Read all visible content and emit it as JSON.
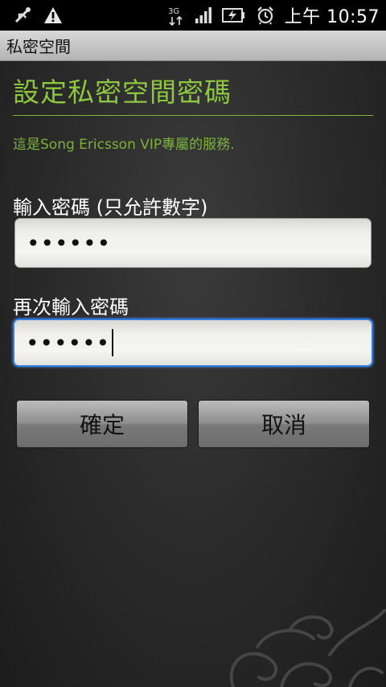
{
  "status_bar": {
    "network": "3G",
    "clock": "上午 10:57"
  },
  "title_bar": {
    "title": "私密空間"
  },
  "form": {
    "heading": "設定私密空間密碼",
    "info": "這是Song Ericsson VIP專屬的服務.",
    "password_label": "輸入密碼 (只允許數字)",
    "password_value": "••••••",
    "confirm_label": "再次輸入密碼",
    "confirm_value": "••••••"
  },
  "buttons": {
    "ok_label": "確定",
    "cancel_label": "取消"
  },
  "colors": {
    "accent_green": "#8dc63f",
    "focus_blue": "#2f7de1"
  }
}
